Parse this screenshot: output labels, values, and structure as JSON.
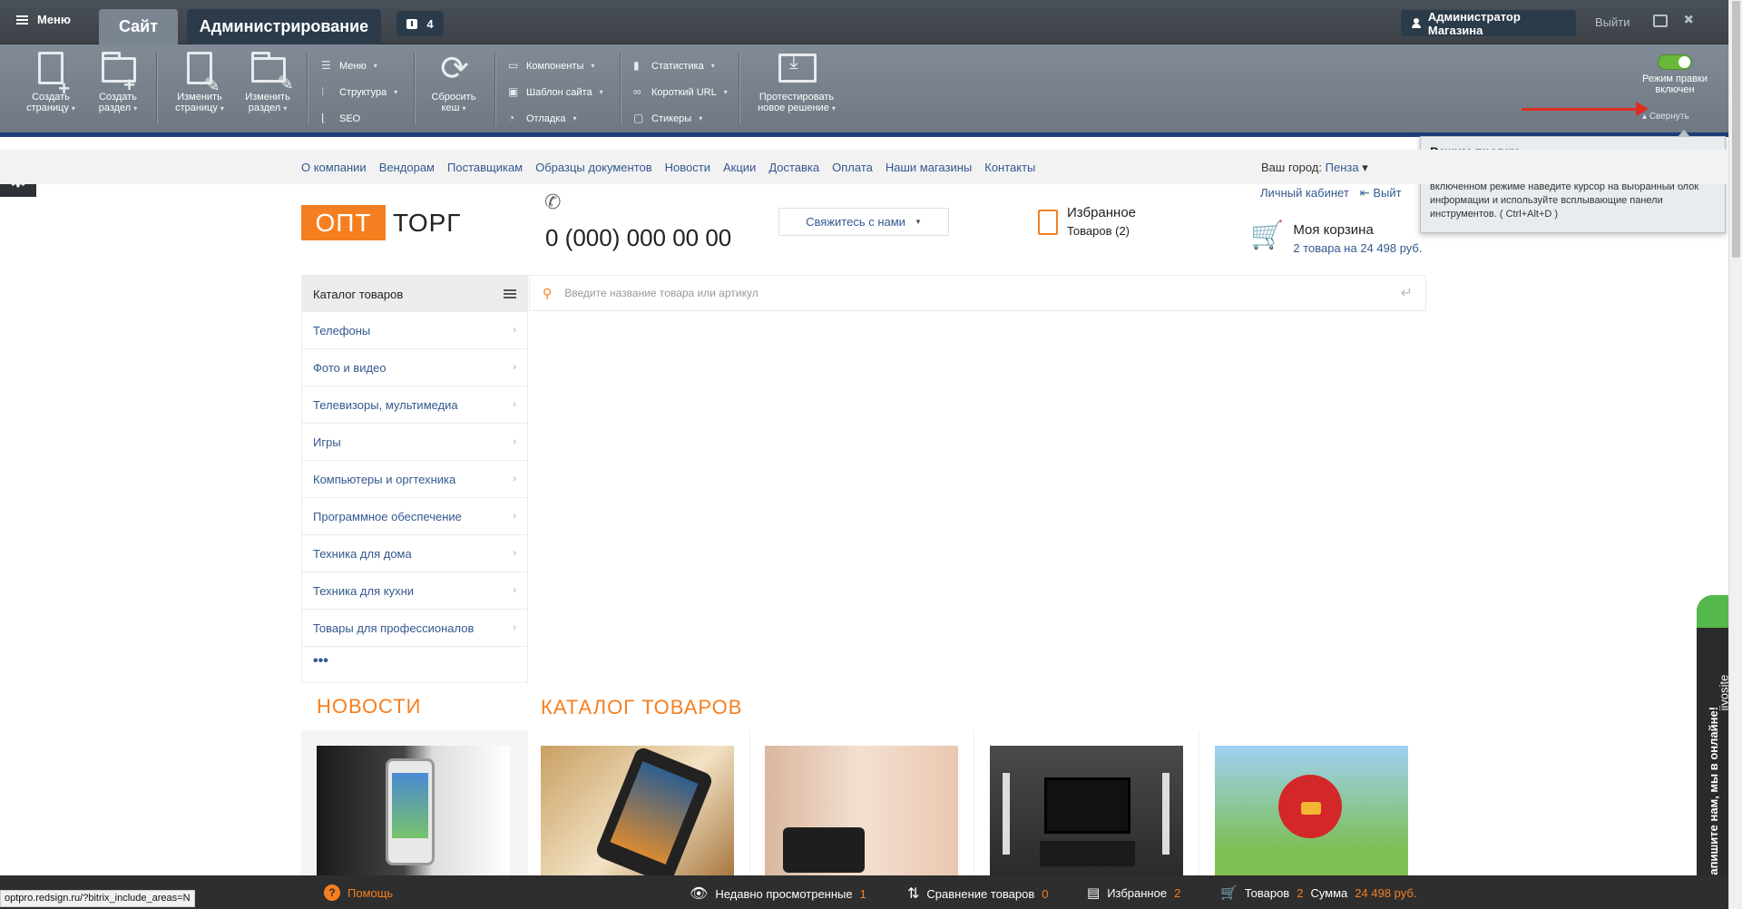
{
  "admin": {
    "menu_label": "Меню",
    "tab_site": "Сайт",
    "tab_admin": "Администрирование",
    "notifications": "4",
    "user": "Администратор Магазина",
    "exit": "Выйти"
  },
  "toolbar": {
    "create_page": [
      "Создать",
      "страницу"
    ],
    "create_section": [
      "Создать",
      "раздел"
    ],
    "edit_page": [
      "Изменить",
      "страницу"
    ],
    "edit_section": [
      "Изменить",
      "раздел"
    ],
    "list1": [
      "Меню",
      "Структура",
      "SEO"
    ],
    "reset_cache": [
      "Сбросить",
      "кеш"
    ],
    "list2": [
      "Компоненты",
      "Шаблон сайта",
      "Отладка"
    ],
    "list3": [
      "Статистика",
      "Короткий URL",
      "Стикеры"
    ],
    "test_solution": [
      "Протестировать",
      "новое решение"
    ],
    "edit_mode": [
      "Режим правки",
      "включен"
    ],
    "collapse": "Свернуть"
  },
  "tooltip": {
    "title": "Режим правки",
    "text": "Включение режима контекстного редактирования сайта. При включенном режиме наведите курсор на выбранный блок информации и используйте всплывающие панели инструментов. ( Ctrl+Alt+D )"
  },
  "site": {
    "nav": [
      "О компании",
      "Вендорам",
      "Поставщикам",
      "Образцы документов",
      "Новости",
      "Акции",
      "Доставка",
      "Оплата",
      "Наши магазины",
      "Контакты"
    ],
    "city_label": "Ваш город:",
    "city": "Пенза",
    "logo_opt": "ОПТ",
    "logo_torg": "ТОРГ",
    "phone": "0 (000) 000 00 00",
    "contact_btn": "Свяжитесь с нами",
    "fav_title": "Избранное",
    "fav_count": "Товаров (2)",
    "account": "Личный кабинет",
    "logout": "Выйт",
    "cart_title": "Моя корзина",
    "cart_info": "2 товара на 24 498 руб.",
    "catalog_title": "Каталог товаров",
    "catalog_items": [
      "Телефоны",
      "Фото и видео",
      "Телевизоры, мультимедиа",
      "Игры",
      "Компьютеры и оргтехника",
      "Программное обеспечение",
      "Техника для дома",
      "Техника для кухни",
      "Товары для профессионалов"
    ],
    "catalog_more": "•••",
    "search_placeholder": "Введите название товара или артикул",
    "news_title": "НОВОСТИ",
    "catalog_section_title": "КАТАЛОГ ТОВАРОВ"
  },
  "jivo": {
    "brand": "jivosite",
    "text": "Напишите нам, мы в онлайне!"
  },
  "bottom": {
    "help": "Помощь",
    "recent": "Недавно просмотренные",
    "recent_count": "1",
    "compare": "Сравнение товаров",
    "compare_count": "0",
    "fav": "Избранное",
    "fav_count": "2",
    "cart": "Товаров",
    "cart_count": "2",
    "sum_label": "Сумма",
    "sum": "24 498 руб."
  },
  "status_url": "optpro.redsign.ru/?bitrix_include_areas=N",
  "colors": {
    "accent": "#f57f20",
    "link": "#33598f",
    "toggle_on": "#69b73b",
    "admin_dark": "#2c3b4a"
  }
}
